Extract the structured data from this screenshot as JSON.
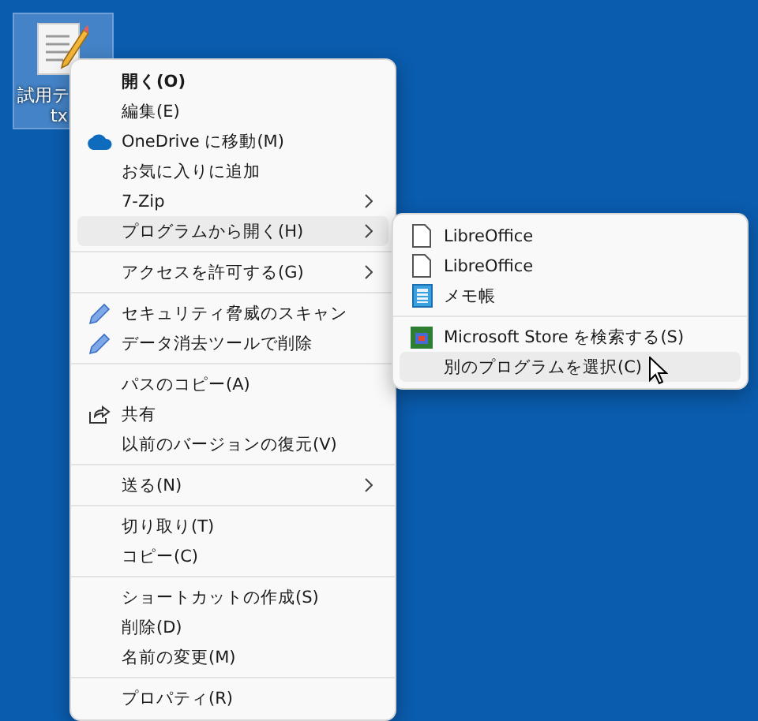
{
  "desktop_icon": {
    "label_lines": [
      "試用テ",
      "tx"
    ],
    "selected": true
  },
  "context_menu": {
    "groups": [
      {
        "items": [
          {
            "label": "開く(O)",
            "kind": "plain",
            "default": true,
            "submenu": false,
            "selected": false
          },
          {
            "label": "編集(E)",
            "kind": "plain",
            "default": false,
            "submenu": false,
            "selected": false
          },
          {
            "label": "OneDrive に移動(M)",
            "kind": "cloud",
            "default": false,
            "submenu": false,
            "selected": false
          },
          {
            "label": "お気に入りに追加",
            "kind": "plain",
            "default": false,
            "submenu": false,
            "selected": false
          },
          {
            "label": "7-Zip",
            "kind": "plain",
            "default": false,
            "submenu": true,
            "selected": false
          },
          {
            "label": "プログラムから開く(H)",
            "kind": "plain",
            "default": false,
            "submenu": true,
            "selected": true
          }
        ]
      },
      {
        "items": [
          {
            "label": "アクセスを許可する(G)",
            "kind": "plain",
            "default": false,
            "submenu": true,
            "selected": false
          }
        ]
      },
      {
        "items": [
          {
            "label": "セキュリティ脅威のスキャン",
            "kind": "pen",
            "default": false,
            "submenu": false,
            "selected": false
          },
          {
            "label": "データ消去ツールで削除",
            "kind": "pen",
            "default": false,
            "submenu": false,
            "selected": false
          }
        ]
      },
      {
        "items": [
          {
            "label": "パスのコピー(A)",
            "kind": "plain",
            "default": false,
            "submenu": false,
            "selected": false
          },
          {
            "label": "共有",
            "kind": "share",
            "default": false,
            "submenu": false,
            "selected": false
          },
          {
            "label": "以前のバージョンの復元(V)",
            "kind": "plain",
            "default": false,
            "submenu": false,
            "selected": false
          }
        ]
      },
      {
        "items": [
          {
            "label": "送る(N)",
            "kind": "plain",
            "default": false,
            "submenu": true,
            "selected": false
          }
        ]
      },
      {
        "items": [
          {
            "label": "切り取り(T)",
            "kind": "plain",
            "default": false,
            "submenu": false,
            "selected": false
          },
          {
            "label": "コピー(C)",
            "kind": "plain",
            "default": false,
            "submenu": false,
            "selected": false
          }
        ]
      },
      {
        "items": [
          {
            "label": "ショートカットの作成(S)",
            "kind": "plain",
            "default": false,
            "submenu": false,
            "selected": false
          },
          {
            "label": "削除(D)",
            "kind": "plain",
            "default": false,
            "submenu": false,
            "selected": false
          },
          {
            "label": "名前の変更(M)",
            "kind": "plain",
            "default": false,
            "submenu": false,
            "selected": false
          }
        ]
      },
      {
        "items": [
          {
            "label": "プロパティ(R)",
            "kind": "plain",
            "default": false,
            "submenu": false,
            "selected": false
          }
        ]
      }
    ]
  },
  "submenu": {
    "groups": [
      {
        "items": [
          {
            "label": "LibreOffice",
            "kind": "document",
            "selected": false
          },
          {
            "label": "LibreOffice",
            "kind": "document",
            "selected": false
          },
          {
            "label": "メモ帳",
            "kind": "notepad",
            "selected": false
          }
        ]
      },
      {
        "items": [
          {
            "label": "Microsoft Store を検索する(S)",
            "kind": "store",
            "selected": false
          },
          {
            "label": "別のプログラムを選択(C)",
            "kind": "plain",
            "selected": true
          }
        ]
      }
    ]
  }
}
